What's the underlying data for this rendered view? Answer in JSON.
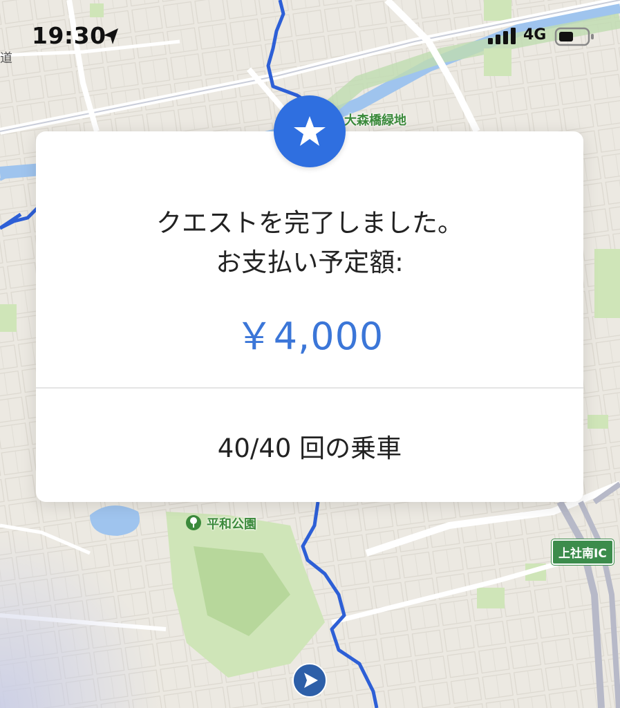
{
  "status_bar": {
    "time": "19:30",
    "location_icon": "location-arrow-icon",
    "signal_icon": "cellular-signal-icon",
    "network": "4G",
    "battery_icon": "battery-icon"
  },
  "map": {
    "labels": {
      "green_space": "大森橋緑地",
      "park": "平和公園",
      "interchange": "上社南IC",
      "road_fragment": "道"
    },
    "colors": {
      "route": "#2d5fd6",
      "park": "#cfe5b8",
      "water": "#9fc4ee",
      "base": "#ece9e2"
    }
  },
  "card": {
    "badge_icon": "star-icon",
    "message_line1": "クエストを完了しました。",
    "message_line2": "お支払い予定額:",
    "amount": "￥4,000",
    "rides": "40/40 回の乗車",
    "accent_color": "#3b76d8"
  }
}
